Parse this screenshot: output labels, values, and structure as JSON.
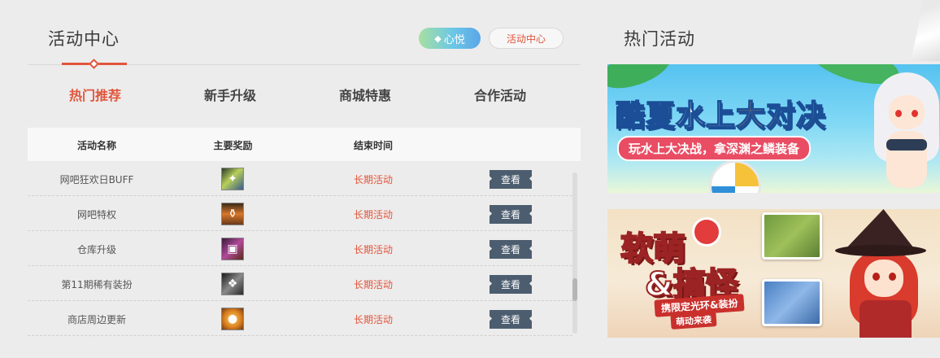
{
  "header": {
    "title": "活动中心",
    "xinyue_label": "心悦",
    "center_label": "活动中心"
  },
  "tabs": [
    {
      "label": "热门推荐",
      "active": true
    },
    {
      "label": "新手升级",
      "active": false
    },
    {
      "label": "商城特惠",
      "active": false
    },
    {
      "label": "合作活动",
      "active": false
    }
  ],
  "table": {
    "headers": {
      "name": "活动名称",
      "reward": "主要奖励",
      "end": "结束时间"
    },
    "rows": [
      {
        "name": "网吧狂欢日BUFF",
        "end": "长期活动",
        "action": "查看",
        "icon": "buff-crystal-icon"
      },
      {
        "name": "网吧特权",
        "end": "长期活动",
        "action": "查看",
        "icon": "potion-bottle-icon"
      },
      {
        "name": "仓库升级",
        "end": "长期活动",
        "action": "查看",
        "icon": "storage-box-icon"
      },
      {
        "name": "第11期稀有装扮",
        "end": "长期活动",
        "action": "查看",
        "icon": "costume-icon"
      },
      {
        "name": "商店周边更新",
        "end": "长期活动",
        "action": "查看",
        "icon": "shop-goods-icon"
      }
    ]
  },
  "hot": {
    "title": "热门活动",
    "banner1": {
      "title_parts": [
        "酷夏",
        "水上",
        "大对决"
      ],
      "subtitle": "玩水上大决战，拿深渊之鳞装备"
    },
    "banner2": {
      "title_line1": "软萌",
      "title_line2": "&搞怪",
      "subtitle1": "携限定光环&装扮",
      "subtitle2": "萌动来袭"
    }
  },
  "colors": {
    "accent": "#e2553b",
    "button": "#4c5d6f",
    "background": "#ececec"
  }
}
